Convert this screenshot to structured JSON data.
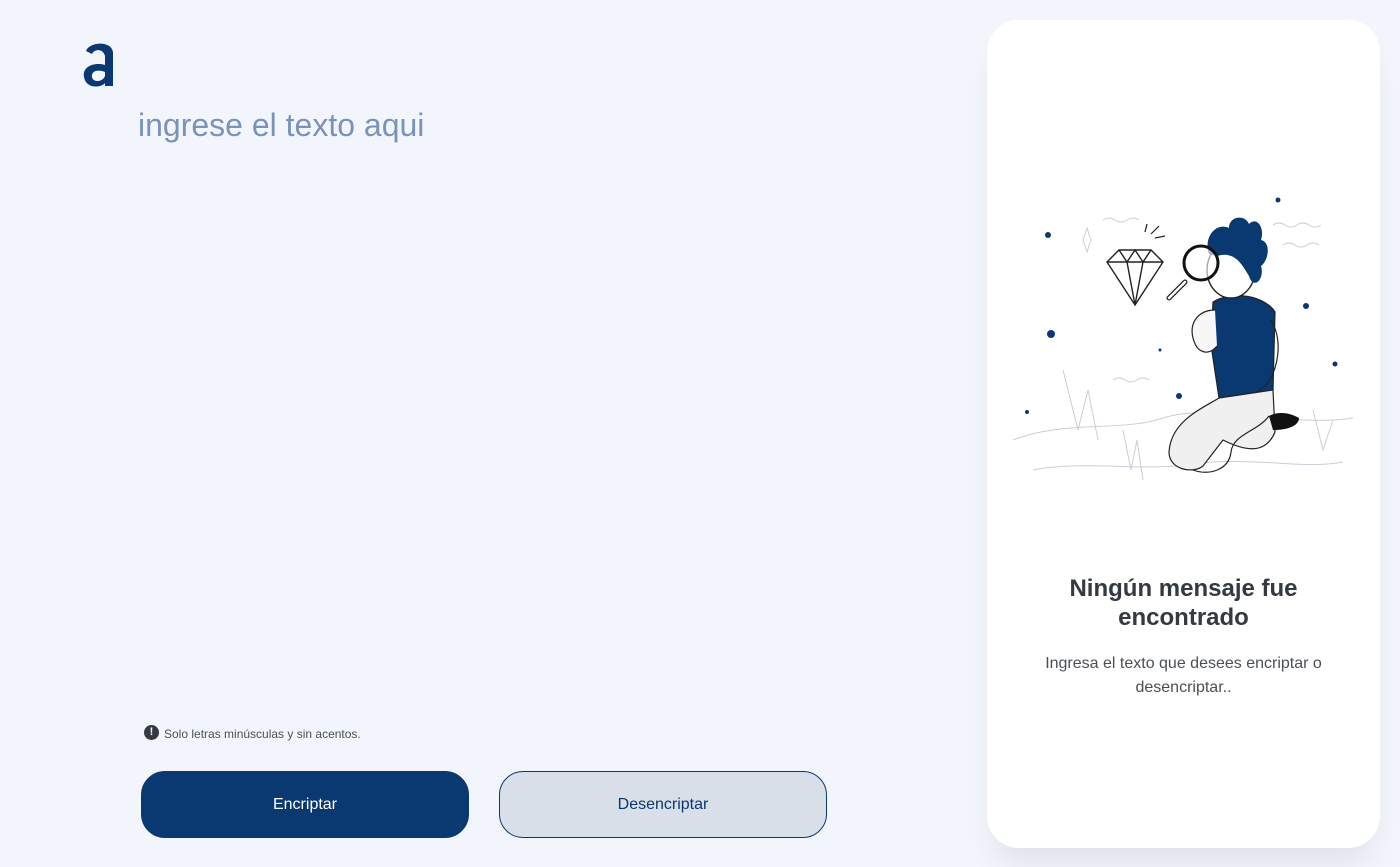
{
  "app": {
    "logo": "alura-logo"
  },
  "editor": {
    "placeholder": "ingrese el texto aqui",
    "value": ""
  },
  "hint": {
    "icon": "exclamation-circle-icon",
    "text": "Solo letras minúsculas y sin acentos."
  },
  "actions": {
    "encrypt_label": "Encriptar",
    "decrypt_label": "Desencriptar"
  },
  "output_panel": {
    "illustration": "person-with-magnifying-glass-illustration",
    "title": "Ningún mensaje fue encontrado",
    "description": "Ingresa el texto que desees encriptar o desencriptar.."
  },
  "colors": {
    "background": "#f3f5fc",
    "primary": "#0a3871",
    "secondary_button": "#d8dfe8",
    "placeholder": "#7a93b8",
    "panel": "#ffffff"
  }
}
